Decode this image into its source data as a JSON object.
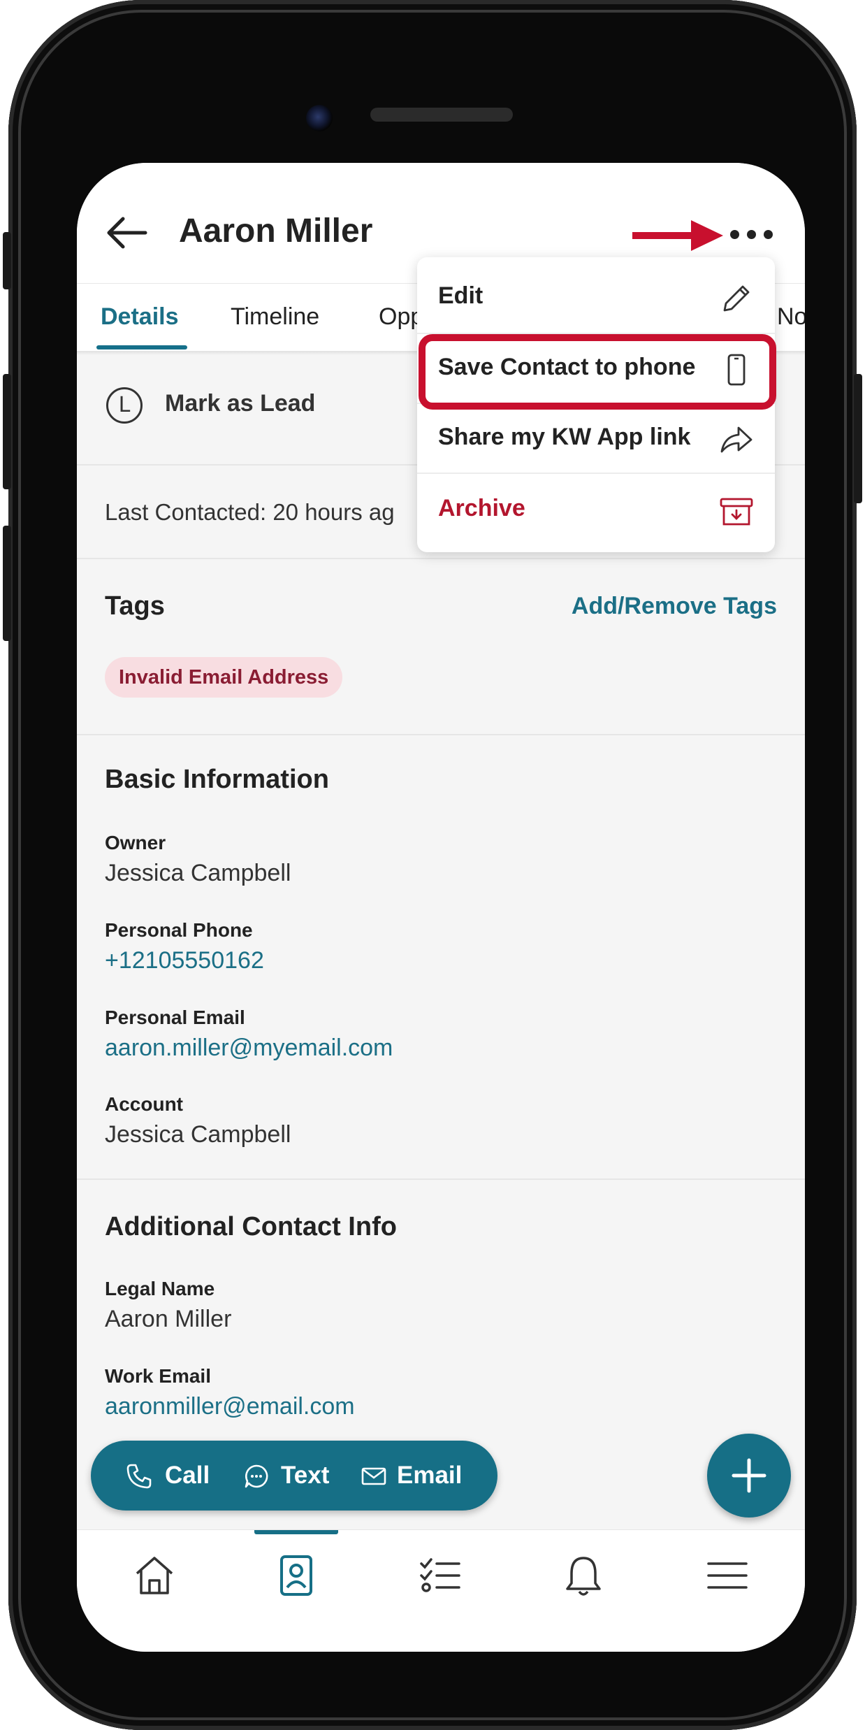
{
  "header": {
    "title": "Aaron Miller",
    "back_icon": "arrow-left-icon",
    "more_icon": "more-horizontal-icon"
  },
  "tabs": [
    {
      "label": "Details",
      "active": true
    },
    {
      "label": "Timeline",
      "active": false
    },
    {
      "label": "Opp",
      "active": false
    },
    {
      "label": "No",
      "active": false
    }
  ],
  "menu": {
    "items": [
      {
        "label": "Edit",
        "icon": "pencil-icon"
      },
      {
        "label": "Save Contact to phone",
        "icon": "phone-icon"
      },
      {
        "label": "Share my KW App link",
        "icon": "share-icon"
      },
      {
        "label": "Archive",
        "icon": "archive-icon",
        "color": "#b3162e"
      }
    ]
  },
  "lead": {
    "icon_letter": "L",
    "label": "Mark as Lead"
  },
  "last_contacted": "Last Contacted: 20 hours ag",
  "tags": {
    "title": "Tags",
    "link": "Add/Remove Tags",
    "items": [
      "Invalid Email Address"
    ]
  },
  "basic_info": {
    "title": "Basic Information",
    "fields": [
      {
        "label": "Owner",
        "value": "Jessica Campbell"
      },
      {
        "label": "Personal Phone",
        "value": "+12105550162"
      },
      {
        "label": "Personal Email",
        "value": "aaron.miller@myemail.com"
      },
      {
        "label": "Account",
        "value": "Jessica Campbell"
      }
    ]
  },
  "additional_info": {
    "title": "Additional Contact Info",
    "fields": [
      {
        "label": "Legal Name",
        "value": "Aaron Miller"
      },
      {
        "label": "Work Email",
        "value": "aaronmiller@email.com"
      }
    ]
  },
  "actions": {
    "call": "Call",
    "text": "Text",
    "email": "Email"
  },
  "colors": {
    "accent": "#166f86",
    "highlight": "#c8102e",
    "tag_bg": "#f8dde1",
    "tag_text": "#8a1d33"
  },
  "bottom_nav": [
    "home-icon",
    "contacts-icon",
    "tasks-icon",
    "notifications-icon",
    "menu-icon"
  ]
}
